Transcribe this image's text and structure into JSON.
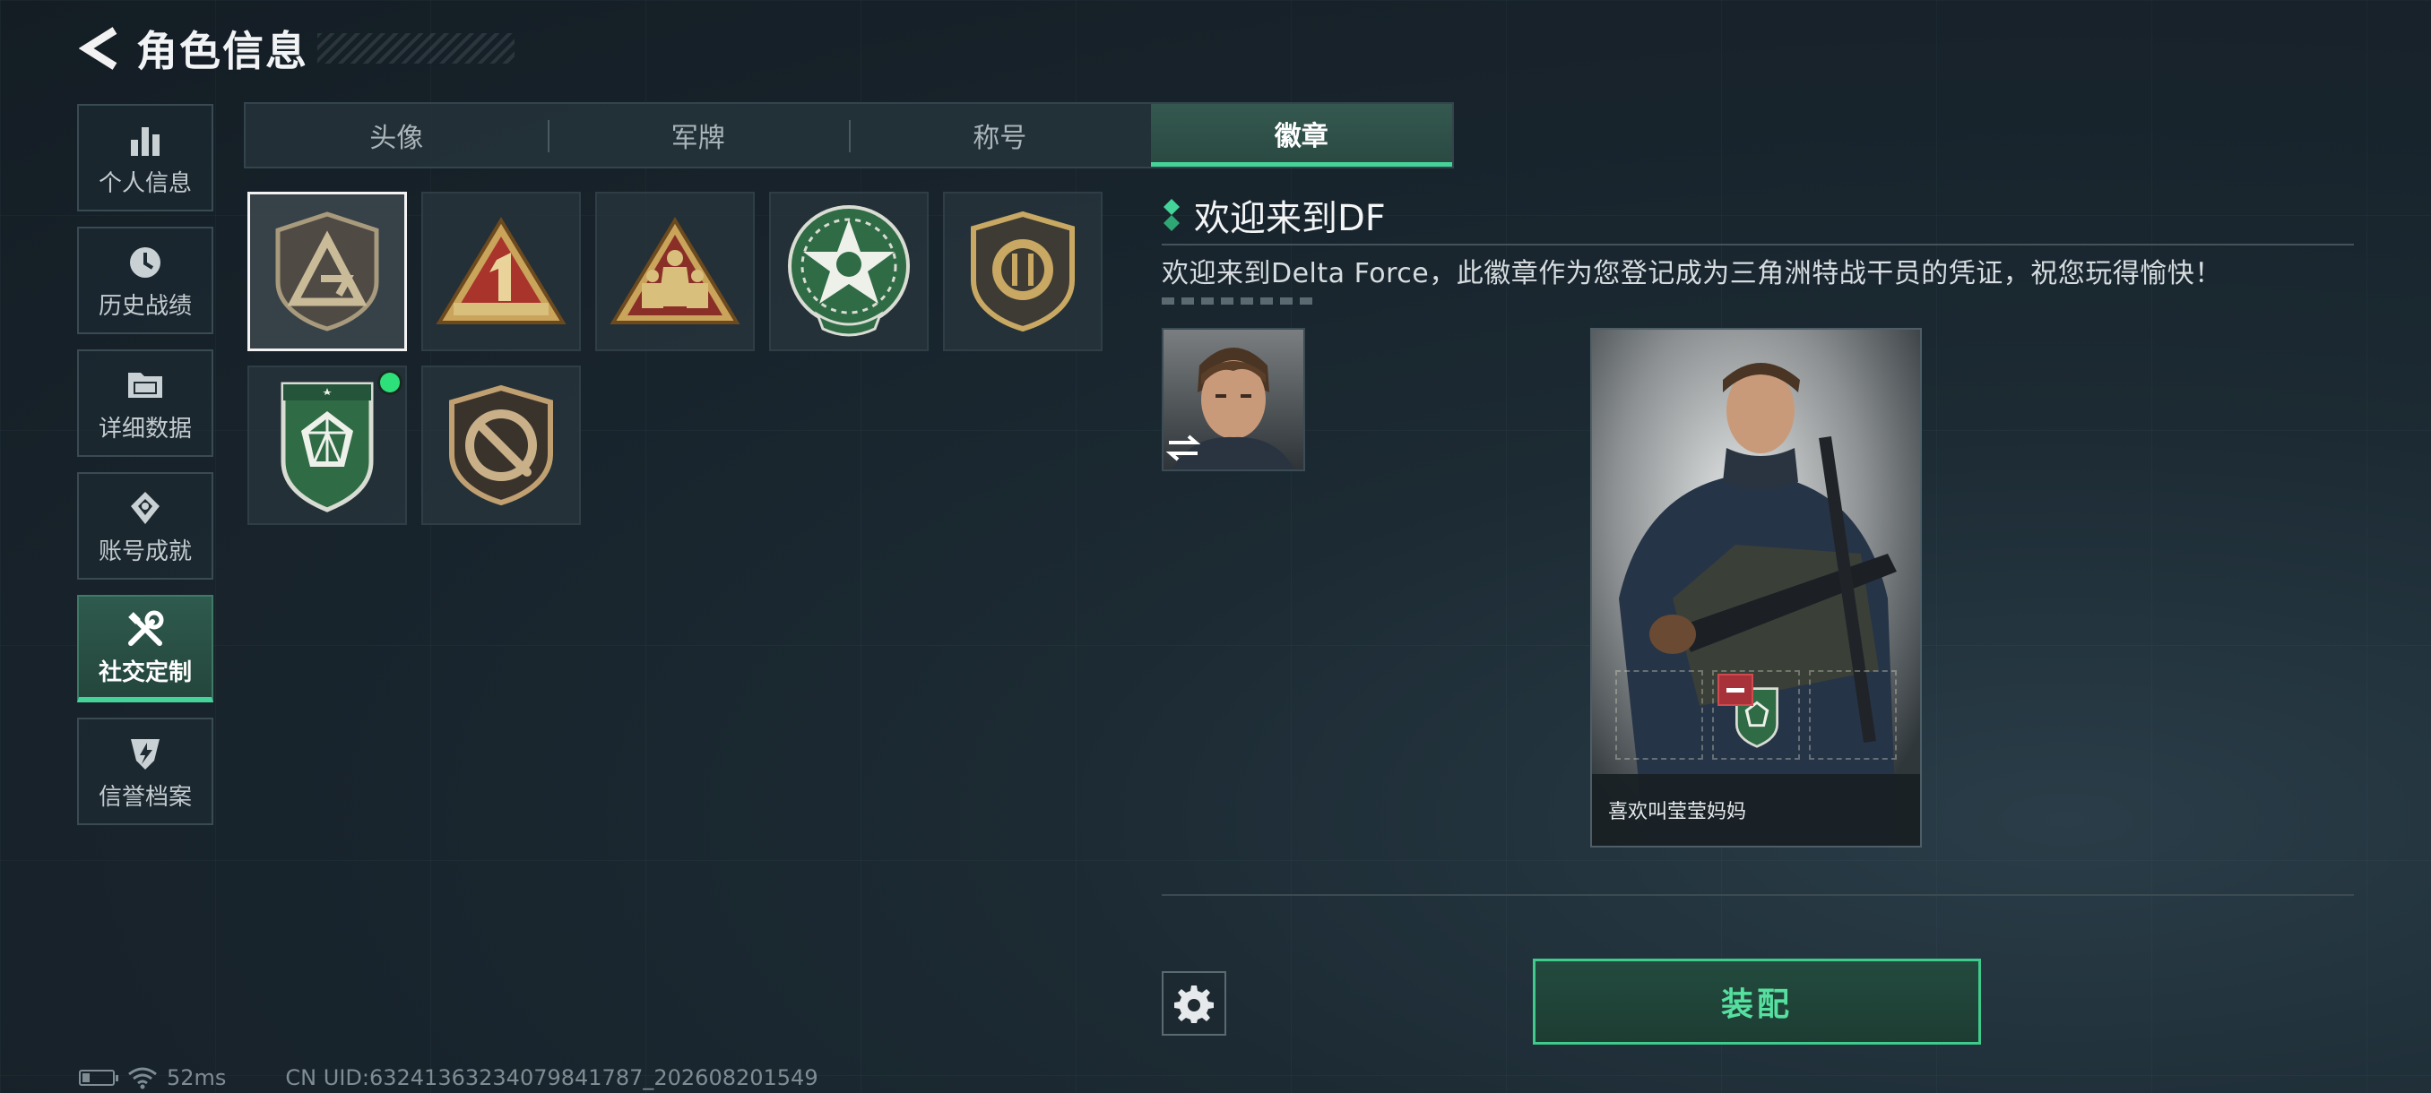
{
  "header": {
    "title": "角色信息"
  },
  "sidebar": {
    "items": [
      {
        "label": "个人信息",
        "icon": "bar-chart-icon"
      },
      {
        "label": "历史战绩",
        "icon": "clock-icon"
      },
      {
        "label": "详细数据",
        "icon": "folder-icon"
      },
      {
        "label": "账号成就",
        "icon": "achievement-icon"
      },
      {
        "label": "社交定制",
        "icon": "tools-icon",
        "active": true
      },
      {
        "label": "信誉档案",
        "icon": "credit-shield-icon"
      }
    ]
  },
  "tabs": [
    {
      "label": "头像"
    },
    {
      "label": "军牌"
    },
    {
      "label": "称号"
    },
    {
      "label": "徽章",
      "active": true
    }
  ],
  "badges": [
    {
      "name": "delta-triangle-badge",
      "selected": true
    },
    {
      "name": "number-one-badge"
    },
    {
      "name": "squad-badge"
    },
    {
      "name": "green-star-badge"
    },
    {
      "name": "gold-shield-badge"
    },
    {
      "name": "green-diamond-badge",
      "new": true
    },
    {
      "name": "knife-badge"
    }
  ],
  "detail": {
    "title": "欢迎来到DF",
    "description": "欢迎来到Delta Force，此徽章作为您登记成为三角洲特战干员的凭证，祝您玩得愉快！",
    "card_name": "喜欢叫莹莹妈妈"
  },
  "actions": {
    "equip_label": "装配"
  },
  "status": {
    "ping": "52ms",
    "uid": "CN UID:63241363234079841787_202608201549"
  },
  "colors": {
    "accent_green": "#44d49a",
    "new_dot": "#2ee07a",
    "remove_red": "#a8323a"
  }
}
